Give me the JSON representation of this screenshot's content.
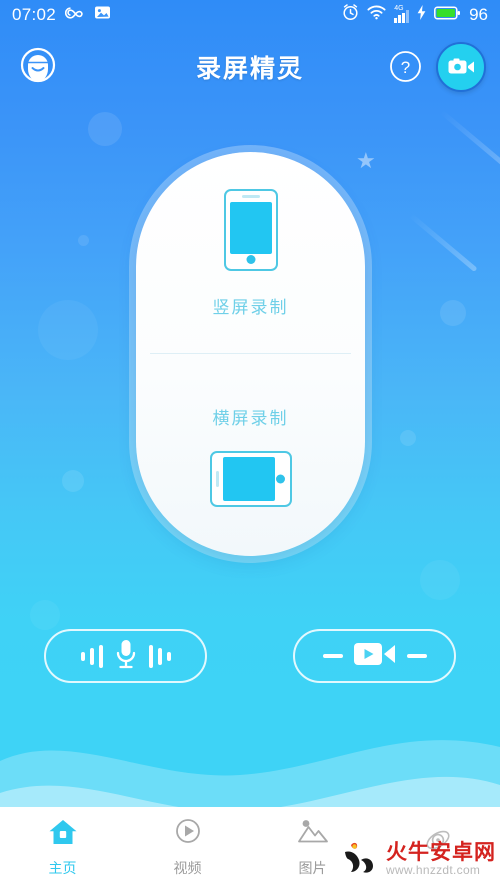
{
  "statusbar": {
    "time": "07:02",
    "battery_percent": "96",
    "network_label": "4G",
    "icons": [
      "infinity-icon",
      "image-icon",
      "alarm-icon",
      "wifi-icon",
      "signal-icon",
      "charging-icon",
      "battery-icon"
    ]
  },
  "header": {
    "title": "录屏精灵",
    "left_icon": "headset-support-icon",
    "help_icon": "help-question-icon",
    "record_icon": "video-camera-icon"
  },
  "main": {
    "modes": [
      {
        "label": "竖屏录制",
        "icon": "phone-portrait-icon"
      },
      {
        "label": "横屏录制",
        "icon": "phone-landscape-icon"
      }
    ],
    "controls": [
      {
        "name": "audio-record-button",
        "icon": "microphone-icon"
      },
      {
        "name": "video-record-button",
        "icon": "video-play-icon"
      }
    ]
  },
  "bottom_nav": {
    "items": [
      {
        "label": "主页",
        "icon": "home-icon",
        "active": true
      },
      {
        "label": "视频",
        "icon": "play-circle-icon",
        "active": false
      },
      {
        "label": "图片",
        "icon": "photo-mountain-icon",
        "active": false
      },
      {
        "label": "",
        "icon": "rocket-discover-icon",
        "active": false
      }
    ]
  },
  "watermark": {
    "title": "火牛安卓网",
    "url": "www.hnzzdt.com",
    "icon": "torch-bull-logo"
  },
  "colors": {
    "bg_top": "#2f8cf7",
    "bg_bottom": "#3ed3f6",
    "accent_cyan": "#22c6f2",
    "label_cyan": "#6fd0e8",
    "nav_active": "#2fc8ee",
    "nav_inactive": "#9b9b9b",
    "battery_green": "#35de2a",
    "watermark_red": "#d4231f"
  }
}
